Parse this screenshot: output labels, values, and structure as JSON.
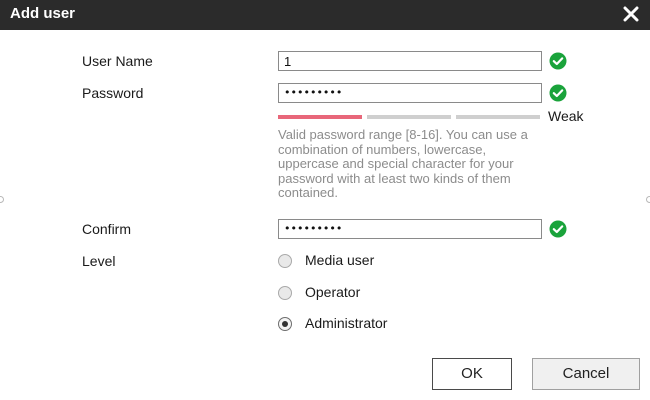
{
  "dialog": {
    "title": "Add user",
    "close_icon": "close-icon"
  },
  "form": {
    "username": {
      "label": "User Name",
      "value": "1",
      "status_icon": "check-circle-icon"
    },
    "password": {
      "label": "Password",
      "value": "•••••••••",
      "status_icon": "check-circle-icon"
    },
    "strength": {
      "level_text": "Weak",
      "level": 1,
      "segments": 3,
      "active_color": "#e8677a",
      "inactive_color": "#cfcfcf"
    },
    "hint": "Valid password range [8-16]. You can use a combination of numbers, lowercase, uppercase and special character for your password with at least two kinds of them contained.",
    "confirm": {
      "label": "Confirm",
      "value": "•••••••••",
      "status_icon": "check-circle-icon"
    },
    "level": {
      "label": "Level",
      "options": [
        {
          "label": "Media user",
          "checked": false
        },
        {
          "label": "Operator",
          "checked": false
        },
        {
          "label": "Administrator",
          "checked": true
        }
      ]
    }
  },
  "buttons": {
    "ok_label": "OK",
    "cancel_label": "Cancel"
  },
  "colors": {
    "titlebar": "#2b2b2b",
    "success": "#1aa33b"
  }
}
